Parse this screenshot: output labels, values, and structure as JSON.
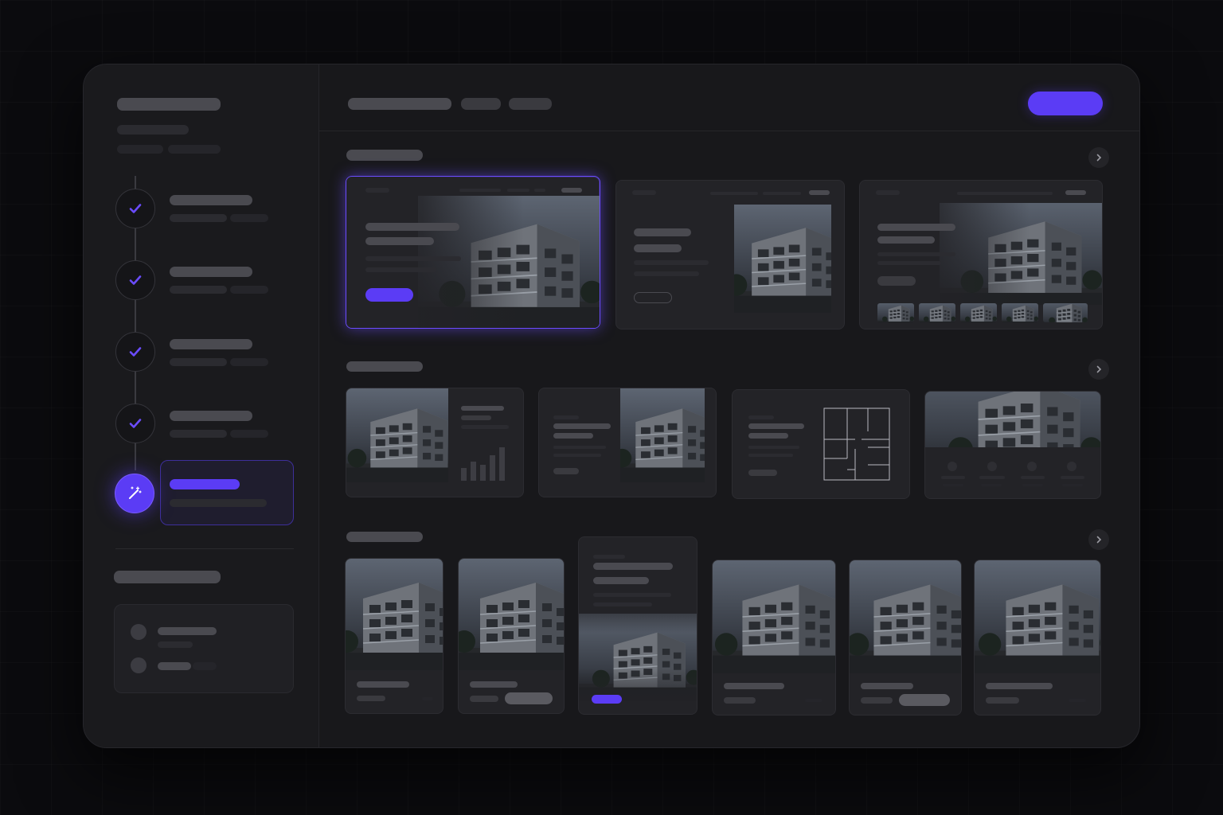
{
  "app": {
    "accent_color": "#5b3cf5",
    "background_color": "#0b0b0e",
    "panel_color": "#18181b"
  },
  "sidebar": {
    "steps": [
      {
        "state": "completed",
        "icon": "check-icon"
      },
      {
        "state": "completed",
        "icon": "check-icon"
      },
      {
        "state": "completed",
        "icon": "check-icon"
      },
      {
        "state": "completed",
        "icon": "check-icon"
      },
      {
        "state": "active",
        "icon": "magic-wand-icon"
      }
    ]
  },
  "header": {
    "primary_button_icon": "none"
  },
  "sections": [
    {
      "id": "hero-layouts",
      "nav_icon": "chevron-right-icon",
      "card_count": 3,
      "selected_card": 1
    },
    {
      "id": "feature-layouts",
      "nav_icon": "chevron-right-icon",
      "card_count": 4
    },
    {
      "id": "gallery-layouts",
      "nav_icon": "chevron-right-icon",
      "card_count": 6
    }
  ],
  "icons": {
    "step_done": "check-icon",
    "step_active": "magic-wand-icon",
    "section_nav": "chevron-right-icon",
    "floor_plan": "floor-plan-icon",
    "bar_chart": "bar-chart-icon"
  }
}
